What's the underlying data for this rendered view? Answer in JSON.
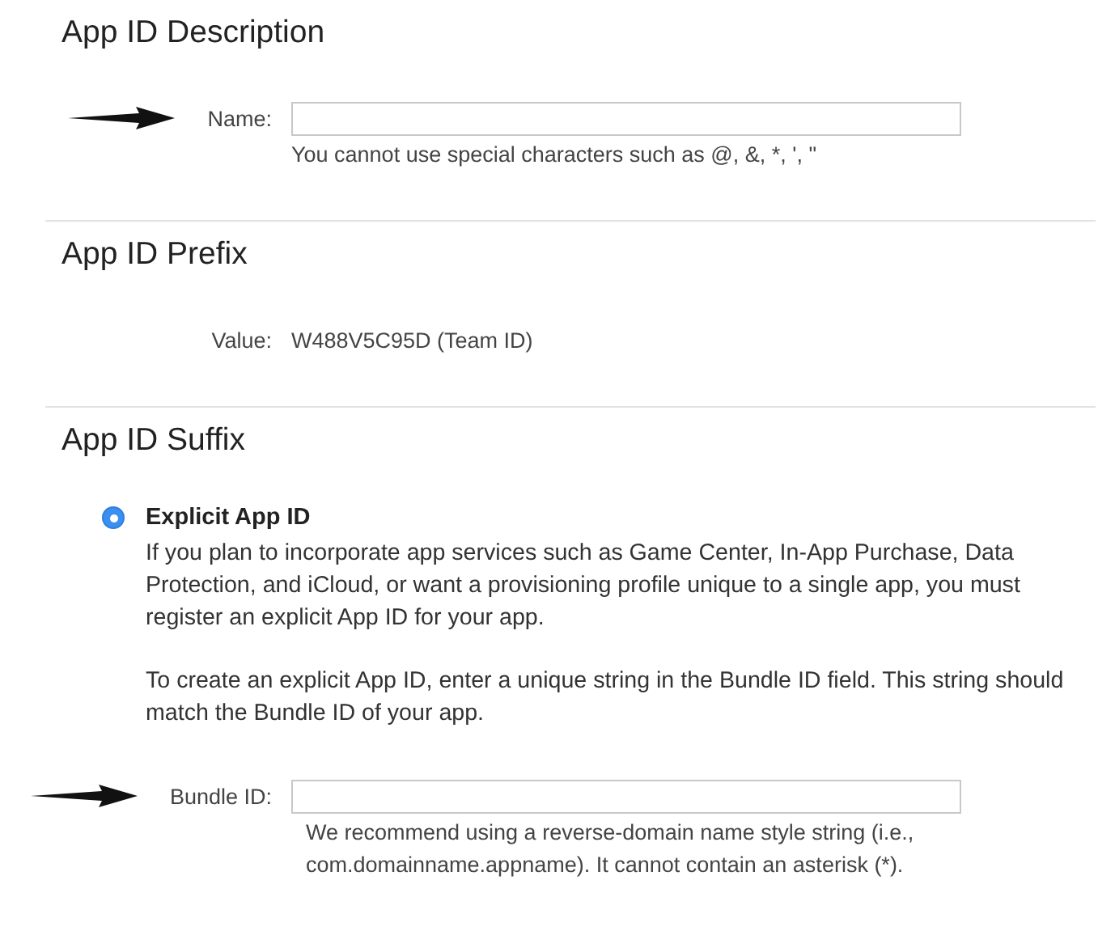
{
  "sections": [
    {
      "title": "App ID Description",
      "rows": [
        {
          "kind": "input",
          "label": "Name:",
          "marked": true,
          "hint": "You cannot use special characters such as @, &, *, ', \""
        }
      ]
    },
    {
      "title": "App ID Prefix",
      "rows": [
        {
          "kind": "value",
          "label": "Value:",
          "marked": false,
          "value": "W488V5C95D (Team ID)"
        }
      ]
    },
    {
      "title": "App ID Suffix",
      "options": [
        {
          "label": "Explicit App ID",
          "selected": true,
          "paragraphs": [
            "If you plan to incorporate app services such as Game Center, In-App Purchase, Data Protection, and iCloud, or want a provisioning profile unique to a single app, you must register an explicit App ID for your app.",
            "To create an explicit App ID, enter a unique string in the Bundle ID field. This string should match the Bundle ID of your app."
          ]
        }
      ],
      "rows": [
        {
          "kind": "input",
          "label": "Bundle ID:",
          "marked": true,
          "hint": "We recommend using a reverse-domain name style string (i.e., com.domainname.appname). It cannot contain an asterisk (*)."
        }
      ]
    }
  ]
}
